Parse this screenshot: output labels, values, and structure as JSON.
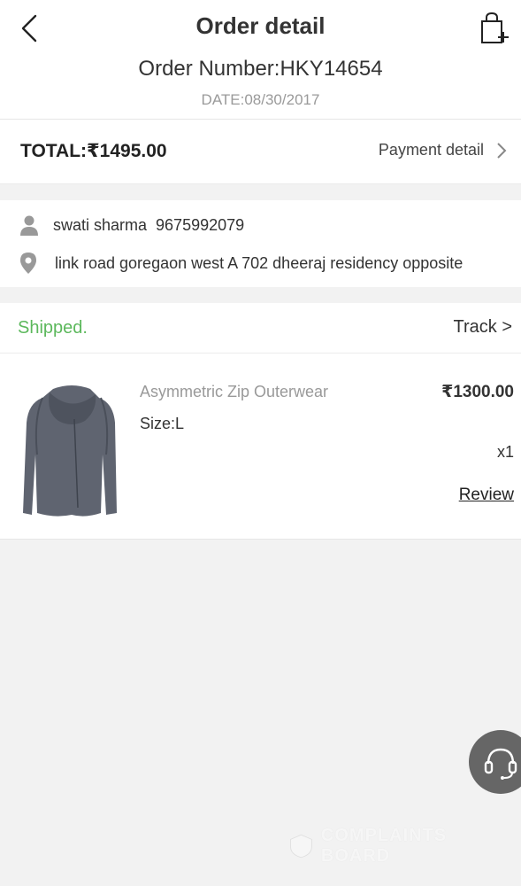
{
  "header": {
    "title": "Order detail",
    "order_number": "Order Number:HKY14654",
    "date": "DATE:08/30/2017"
  },
  "summary": {
    "total": "TOTAL:₹1495.00",
    "payment_label": "Payment detail"
  },
  "address": {
    "name": "swati sharma",
    "phone": "9675992079",
    "line": "link road goregaon west A 702 dheeraj residency opposite"
  },
  "status": {
    "text": "Shipped.",
    "track_label": "Track >"
  },
  "item": {
    "name": "Asymmetric Zip Outerwear",
    "price": "₹1300.00",
    "size": "Size:L",
    "qty": "x1",
    "review_label": "Review"
  },
  "watermark": {
    "text": "COMPLAINTS BOARD"
  },
  "colors": {
    "accent_shipped": "#5cb85c",
    "background": "#f2f2f2"
  },
  "icons": [
    "back-arrow-icon",
    "cart-add-icon",
    "chevron-right-icon",
    "person-icon",
    "location-pin-icon",
    "headset-icon"
  ]
}
